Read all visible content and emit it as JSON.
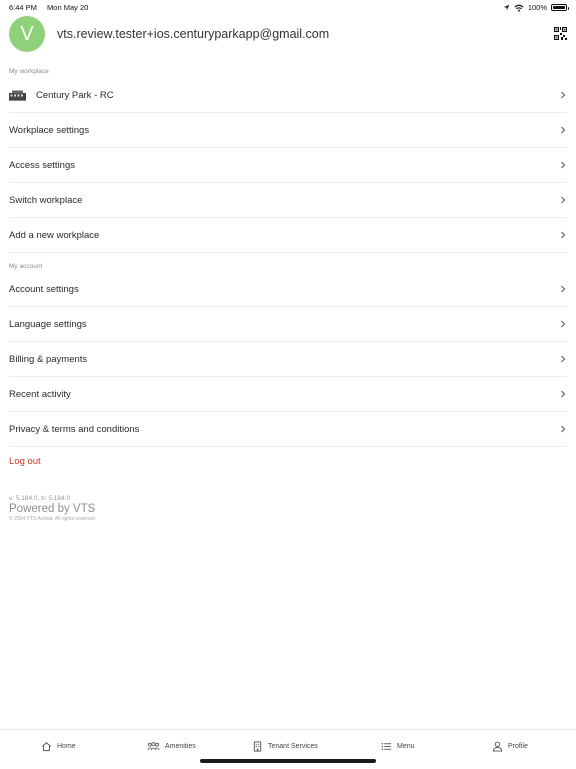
{
  "status": {
    "time": "6:44 PM",
    "date": "Mon May 20",
    "battery": "100%"
  },
  "profile": {
    "initial": "V",
    "email": "vts.review.tester+ios.centuryparkapp@gmail.com"
  },
  "workplace": {
    "label": "My workplace",
    "current": "Century Park - RC",
    "items": [
      {
        "label": "Workplace settings"
      },
      {
        "label": "Access settings"
      },
      {
        "label": "Switch workplace"
      },
      {
        "label": "Add a new workplace"
      }
    ]
  },
  "account": {
    "label": "My account",
    "items": [
      {
        "label": "Account settings"
      },
      {
        "label": "Language settings"
      },
      {
        "label": "Billing & payments"
      },
      {
        "label": "Recent activity"
      },
      {
        "label": "Privacy & terms and conditions"
      }
    ]
  },
  "logout": "Log out",
  "footer": {
    "version": "v: 5.184.0, b: 5.184.0",
    "powered": "Powered by VTS",
    "copyright": "© 2024 VTS Activat. All rights reserved"
  },
  "tabs": [
    {
      "label": "Home",
      "icon": "home-icon"
    },
    {
      "label": "Amenities",
      "icon": "people-icon"
    },
    {
      "label": "Tenant Services",
      "icon": "building-icon"
    },
    {
      "label": "Menu",
      "icon": "list-icon"
    },
    {
      "label": "Profile",
      "icon": "person-icon"
    }
  ],
  "colors": {
    "avatar": "#8fd17a",
    "logout": "#c0392b"
  }
}
